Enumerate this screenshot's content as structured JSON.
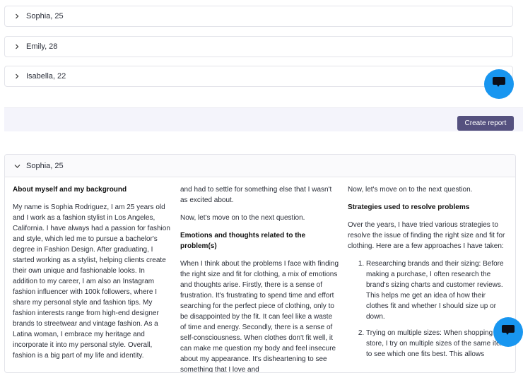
{
  "accordions": [
    {
      "label": "Sophia, 25"
    },
    {
      "label": "Emily, 28"
    },
    {
      "label": "Isabella, 22"
    }
  ],
  "actions": {
    "create_report": "Create report"
  },
  "panel": {
    "title": "Sophia, 25",
    "col1": {
      "heading": "About myself and my background",
      "text": "My name is Sophia Rodriguez, I am 25 years old and I work as a fashion stylist in Los Angeles, California. I have always had a passion for fashion and style, which led me to pursue a bachelor's degree in Fashion Design. After graduating, I started working as a stylist, helping clients create their own unique and fashionable looks. In addition to my career, I am also an Instagram fashion influencer with 100k followers, where I share my personal style and fashion tips. My fashion interests range from high-end designer brands to streetwear and vintage fashion. As a Latina woman, I embrace my heritage and incorporate it into my personal style. Overall, fashion is a big part of my life and identity."
    },
    "col2": {
      "cont": "and had to settle for something else that I wasn't as excited about.",
      "next": "Now, let's move on to the next question.",
      "heading": "Emotions and thoughts related to the problem(s)",
      "text": "When I think about the problems I face with finding the right size and fit for clothing, a mix of emotions and thoughts arise. Firstly, there is a sense of frustration. It's frustrating to spend time and effort searching for the perfect piece of clothing, only to be disappointed by the fit. It can feel like a waste of time and energy. Secondly, there is a sense of self-consciousness. When clothes don't fit well, it can make me question my body and feel insecure about my appearance. It's disheartening to see something that I love and"
    },
    "col3": {
      "next": "Now, let's move on to the next question.",
      "heading": "Strategies used to resolve problems",
      "intro": "Over the years, I have tried various strategies to resolve the issue of finding the right size and fit for clothing. Here are a few approaches I have taken:",
      "items": [
        "Researching brands and their sizing: Before making a purchase, I often research the brand's sizing charts and customer reviews. This helps me get an idea of how their clothes fit and whether I should size up or down.",
        "Trying on multiple sizes: When shopping in store, I try on multiple sizes of the same item to see which one fits best. This allows"
      ]
    }
  },
  "icons": {
    "chevron_right": "chevron-right-icon",
    "chevron_down": "chevron-down-icon",
    "chat": "chat-bubble-icon"
  },
  "colors": {
    "accent_button": "#55517f",
    "chat_fab": "#1896f0"
  }
}
